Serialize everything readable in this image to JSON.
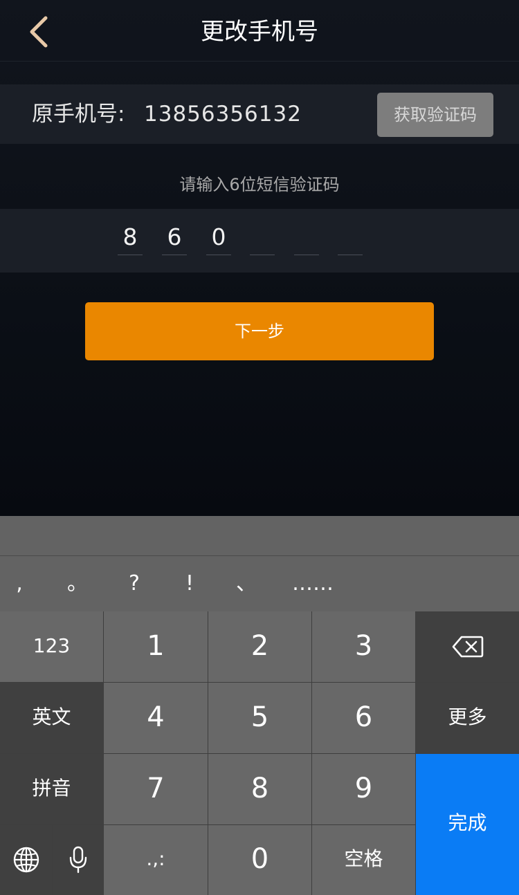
{
  "header": {
    "title": "更改手机号"
  },
  "phone": {
    "label": "原手机号:",
    "number": "13856356132",
    "get_code_label": "获取验证码"
  },
  "code": {
    "hint": "请输入6位短信验证码",
    "digits": [
      "8",
      "6",
      "0",
      "",
      "",
      ""
    ]
  },
  "actions": {
    "next_label": "下一步"
  },
  "keyboard": {
    "punctuation": [
      ",",
      "。",
      "?",
      "!",
      "、",
      "……"
    ],
    "keys": {
      "mode_123": "123",
      "d1": "1",
      "d2": "2",
      "d3": "3",
      "d4": "4",
      "d5": "5",
      "d6": "6",
      "d7": "7",
      "d8": "8",
      "d9": "9",
      "d0": "0",
      "english": "英文",
      "pinyin": "拼音",
      "more": "更多",
      "symbols": ".,:",
      "space": "空格",
      "done": "完成"
    }
  },
  "colors": {
    "accent": "#ea8700",
    "done_key": "#0a7cf5",
    "back_arrow": "#e8c9a8"
  }
}
